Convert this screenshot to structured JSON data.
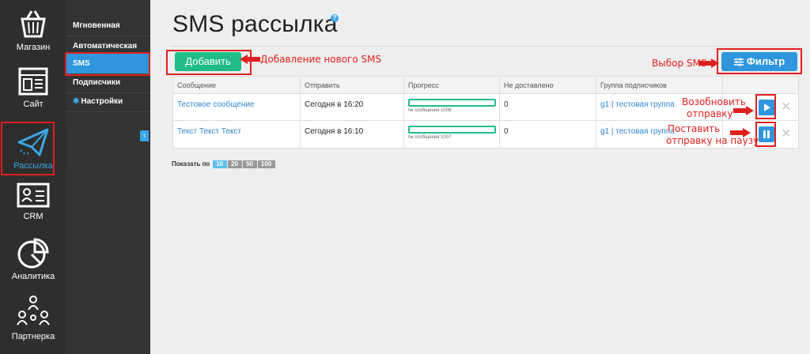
{
  "rail": {
    "items": [
      {
        "label": "Магазин",
        "icon": "basket-icon"
      },
      {
        "label": "Сайт",
        "icon": "website-icon"
      },
      {
        "label": "Рассылка",
        "icon": "paper-plane-icon"
      },
      {
        "label": "CRM",
        "icon": "contact-card-icon"
      },
      {
        "label": "Аналитика",
        "icon": "pie-chart-icon"
      },
      {
        "label": "Партнерка",
        "icon": "network-icon"
      }
    ]
  },
  "submenu": {
    "items": [
      {
        "label": "Мгновенная"
      },
      {
        "label": "Автоматическая"
      },
      {
        "label": "SMS"
      },
      {
        "label": "Подписчики"
      },
      {
        "label": "Настройки"
      }
    ],
    "collapse_glyph": "‹"
  },
  "page": {
    "title": "SMS рассылка",
    "help_glyph": "?"
  },
  "toolbar": {
    "add_label": "Добавить",
    "filter_label": "Фильтр"
  },
  "annotations": {
    "add_note": "Добавление нового SMS",
    "filter_note": "Выбор SMS",
    "resume_note_1": "Возобновить",
    "resume_note_2": "отправку",
    "pause_note_1": "Поставить",
    "pause_note_2": "отправку на паузу"
  },
  "table": {
    "headers": [
      "Сообщение",
      "Отправить",
      "Прогресс",
      "Не доставлено",
      "Группа подписчиков"
    ],
    "rows": [
      {
        "message": "Тестовое сообщение",
        "send": "Сегодня в 16:20",
        "progress_label": "№ сообщения 1008",
        "progress": 0,
        "not_delivered": "0",
        "group": "g1 | тестовая группа",
        "action": "play"
      },
      {
        "message": "Текст Текст Текст",
        "send": "Сегодня в 16:10",
        "progress_label": "№ сообщения 1007",
        "progress": 0,
        "not_delivered": "0",
        "group": "g1 | тестовая группа",
        "action": "pause"
      }
    ]
  },
  "pager": {
    "label": "Показать по",
    "options": [
      "10",
      "20",
      "50",
      "100"
    ],
    "selected": "10"
  },
  "colors": {
    "accent_blue": "#2f96dd",
    "accent_green": "#1fbc8a",
    "annotation_red": "#e0201f"
  }
}
